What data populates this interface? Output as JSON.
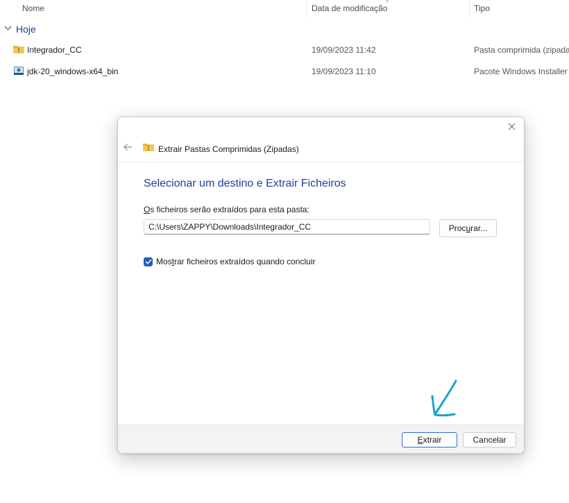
{
  "explorer": {
    "columns": {
      "name": "Nome",
      "date": "Data de modificação",
      "type": "Tipo"
    },
    "group": "Hoje",
    "files": [
      {
        "name": "Integrador_CC",
        "date": "19/09/2023 11:42",
        "type": "Pasta comprimida (zipada",
        "icon": "zip-folder-icon"
      },
      {
        "name": "jdk-20_windows-x64_bin",
        "date": "19/09/2023 11:10",
        "type": "Pacote Windows Installer",
        "icon": "installer-package-icon"
      }
    ]
  },
  "dialog": {
    "title": "Extrair Pastas Comprimidas (Zipadas)",
    "heading": "Selecionar um destino e Extrair Ficheiros",
    "dest_label_key": "O",
    "dest_label_rest": "s ficheiros serão extraídos para esta pasta:",
    "path_value": "C:\\Users\\ZAPPY\\Downloads\\Integrador_CC",
    "browse_pre": "Proc",
    "browse_key": "u",
    "browse_post": "rar...",
    "checkbox_pre": "Mos",
    "checkbox_key": "t",
    "checkbox_post": "rar ficheiros extraídos quando concluir",
    "checkbox_checked": true,
    "extract_key": "E",
    "extract_rest": "xtrair",
    "cancel_label": "Cancelar"
  },
  "colors": {
    "accent": "#1f5fbf",
    "heading": "#1f3f9a",
    "annotation": "#1ba3c6"
  }
}
